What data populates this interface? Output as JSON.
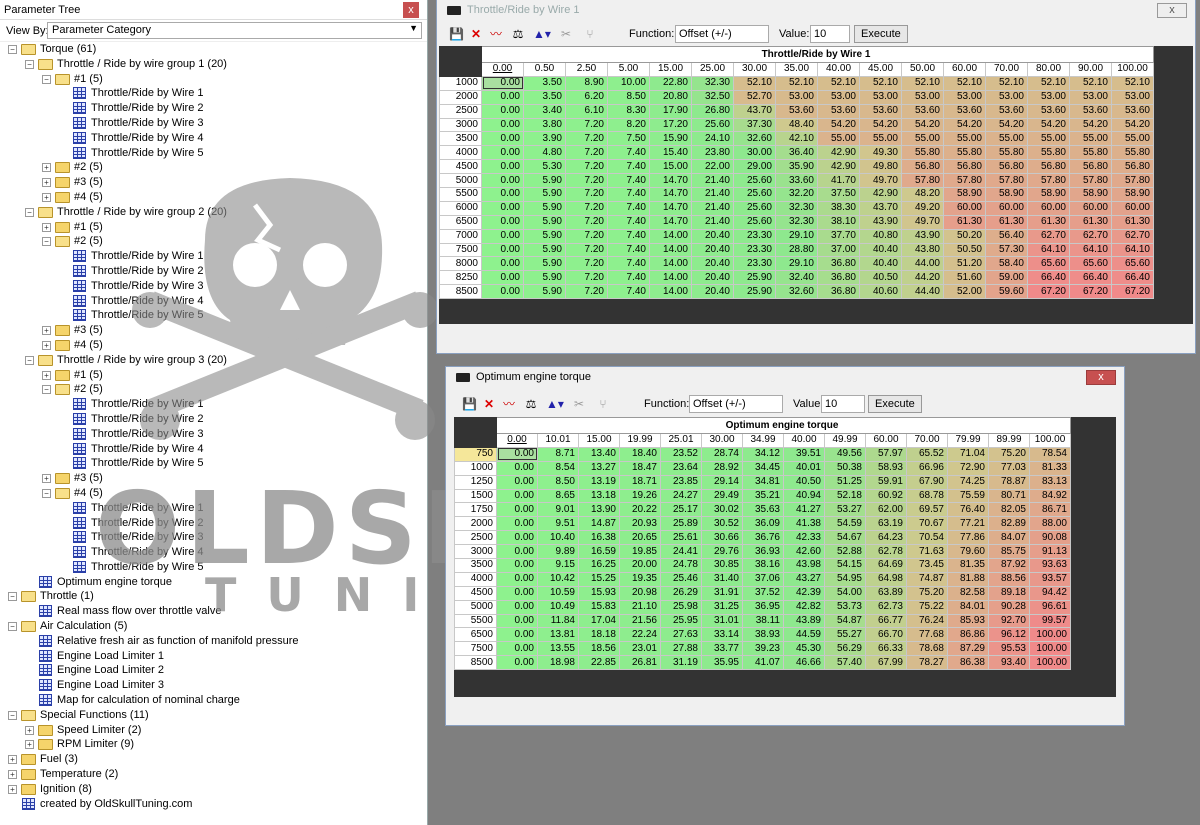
{
  "panel": {
    "title": "Parameter Tree",
    "close": "x",
    "view_by_label": "View By:",
    "view_by_value": "Parameter Category"
  },
  "tree": [
    {
      "d": 0,
      "e": "-",
      "i": "folder-open",
      "t": "Torque (61)"
    },
    {
      "d": 1,
      "e": "-",
      "i": "folder-open",
      "t": "Throttle / Ride by wire group 1 (20)"
    },
    {
      "d": 2,
      "e": "-",
      "i": "folder-open",
      "t": "#1 (5)"
    },
    {
      "d": 3,
      "e": "",
      "i": "table",
      "t": "Throttle/Ride by Wire 1"
    },
    {
      "d": 3,
      "e": "",
      "i": "table",
      "t": "Throttle/Ride by Wire 2"
    },
    {
      "d": 3,
      "e": "",
      "i": "table",
      "t": "Throttle/Ride by Wire 3"
    },
    {
      "d": 3,
      "e": "",
      "i": "table",
      "t": "Throttle/Ride by Wire 4"
    },
    {
      "d": 3,
      "e": "",
      "i": "table",
      "t": "Throttle/Ride by Wire 5"
    },
    {
      "d": 2,
      "e": "+",
      "i": "folder",
      "t": "#2 (5)"
    },
    {
      "d": 2,
      "e": "+",
      "i": "folder",
      "t": "#3 (5)"
    },
    {
      "d": 2,
      "e": "+",
      "i": "folder",
      "t": "#4 (5)"
    },
    {
      "d": 1,
      "e": "-",
      "i": "folder-open",
      "t": "Throttle / Ride by wire group 2 (20)"
    },
    {
      "d": 2,
      "e": "+",
      "i": "folder",
      "t": "#1 (5)"
    },
    {
      "d": 2,
      "e": "-",
      "i": "folder-open",
      "t": "#2 (5)"
    },
    {
      "d": 3,
      "e": "",
      "i": "table",
      "t": "Throttle/Ride by Wire 1"
    },
    {
      "d": 3,
      "e": "",
      "i": "table",
      "t": "Throttle/Ride by Wire 2"
    },
    {
      "d": 3,
      "e": "",
      "i": "table",
      "t": "Throttle/Ride by Wire 3"
    },
    {
      "d": 3,
      "e": "",
      "i": "table",
      "t": "Throttle/Ride by Wire 4"
    },
    {
      "d": 3,
      "e": "",
      "i": "table",
      "t": "Throttle/Ride by Wire 5"
    },
    {
      "d": 2,
      "e": "+",
      "i": "folder",
      "t": "#3 (5)"
    },
    {
      "d": 2,
      "e": "+",
      "i": "folder",
      "t": "#4 (5)"
    },
    {
      "d": 1,
      "e": "-",
      "i": "folder-open",
      "t": "Throttle / Ride by wire group 3 (20)"
    },
    {
      "d": 2,
      "e": "+",
      "i": "folder",
      "t": "#1 (5)"
    },
    {
      "d": 2,
      "e": "-",
      "i": "folder-open",
      "t": "#2 (5)"
    },
    {
      "d": 3,
      "e": "",
      "i": "table",
      "t": "Throttle/Ride by Wire 1"
    },
    {
      "d": 3,
      "e": "",
      "i": "table",
      "t": "Throttle/Ride by Wire 2"
    },
    {
      "d": 3,
      "e": "",
      "i": "table",
      "t": "Throttle/Ride by Wire 3"
    },
    {
      "d": 3,
      "e": "",
      "i": "table",
      "t": "Throttle/Ride by Wire 4"
    },
    {
      "d": 3,
      "e": "",
      "i": "table",
      "t": "Throttle/Ride by Wire 5"
    },
    {
      "d": 2,
      "e": "+",
      "i": "folder",
      "t": "#3 (5)"
    },
    {
      "d": 2,
      "e": "-",
      "i": "folder-open",
      "t": "#4 (5)"
    },
    {
      "d": 3,
      "e": "",
      "i": "table",
      "t": "Throttle/Ride by Wire 1"
    },
    {
      "d": 3,
      "e": "",
      "i": "table",
      "t": "Throttle/Ride by Wire 2"
    },
    {
      "d": 3,
      "e": "",
      "i": "table",
      "t": "Throttle/Ride by Wire 3"
    },
    {
      "d": 3,
      "e": "",
      "i": "table",
      "t": "Throttle/Ride by Wire 4"
    },
    {
      "d": 3,
      "e": "",
      "i": "table",
      "t": "Throttle/Ride by Wire 5"
    },
    {
      "d": 1,
      "e": "",
      "i": "table",
      "t": "Optimum engine torque"
    },
    {
      "d": 0,
      "e": "-",
      "i": "folder-open",
      "t": "Throttle (1)"
    },
    {
      "d": 1,
      "e": "",
      "i": "table",
      "t": "Real mass flow over throttle valve"
    },
    {
      "d": 0,
      "e": "-",
      "i": "folder-open",
      "t": "Air Calculation (5)"
    },
    {
      "d": 1,
      "e": "",
      "i": "table",
      "t": "Relative fresh air as function of manifold pressure"
    },
    {
      "d": 1,
      "e": "",
      "i": "table",
      "t": "Engine Load Limiter 1"
    },
    {
      "d": 1,
      "e": "",
      "i": "table",
      "t": "Engine Load Limiter 2"
    },
    {
      "d": 1,
      "e": "",
      "i": "table",
      "t": "Engine Load Limiter 3"
    },
    {
      "d": 1,
      "e": "",
      "i": "table",
      "t": "Map for calculation of nominal charge"
    },
    {
      "d": 0,
      "e": "-",
      "i": "folder-open",
      "t": "Special Functions (11)"
    },
    {
      "d": 1,
      "e": "+",
      "i": "folder",
      "t": "Speed Limiter (2)"
    },
    {
      "d": 1,
      "e": "+",
      "i": "folder",
      "t": "RPM Limiter (9)"
    },
    {
      "d": 0,
      "e": "+",
      "i": "folder",
      "t": "Fuel (3)"
    },
    {
      "d": 0,
      "e": "+",
      "i": "folder",
      "t": "Temperature (2)"
    },
    {
      "d": 0,
      "e": "+",
      "i": "folder",
      "t": "Ignition (8)"
    },
    {
      "d": 0,
      "e": "",
      "i": "table",
      "t": "created by OldSkullTuning.com"
    }
  ],
  "watermark": {
    "line1": "OLDSKULL",
    "line2": "TUNING"
  },
  "win1": {
    "title": "Throttle/Ride by Wire 1",
    "close": "x",
    "function_label": "Function:",
    "function_value": "Offset (+/-)",
    "value_label": "Value:",
    "value": "10",
    "execute": "Execute",
    "table_title": "Throttle/Ride by Wire 1",
    "x": [
      "0.00",
      "0.50",
      "2.50",
      "5.00",
      "15.00",
      "25.00",
      "30.00",
      "35.00",
      "40.00",
      "45.00",
      "50.00",
      "60.00",
      "70.00",
      "80.00",
      "90.00",
      "100.00"
    ],
    "y": [
      "1000",
      "2000",
      "2500",
      "3000",
      "3500",
      "4000",
      "4500",
      "5000",
      "5500",
      "6000",
      "6500",
      "7000",
      "7500",
      "8000",
      "8250",
      "8500"
    ],
    "rows": [
      [
        "0.00",
        "3.50",
        "8.90",
        "10.00",
        "22.80",
        "32.30",
        "52.10",
        "52.10",
        "52.10",
        "52.10",
        "52.10",
        "52.10",
        "52.10",
        "52.10",
        "52.10",
        "52.10"
      ],
      [
        "0.00",
        "3.50",
        "6.20",
        "8.50",
        "20.80",
        "32.50",
        "52.70",
        "53.00",
        "53.00",
        "53.00",
        "53.00",
        "53.00",
        "53.00",
        "53.00",
        "53.00",
        "53.00"
      ],
      [
        "0.00",
        "3.40",
        "6.10",
        "8.30",
        "17.90",
        "26.80",
        "43.70",
        "53.60",
        "53.60",
        "53.60",
        "53.60",
        "53.60",
        "53.60",
        "53.60",
        "53.60",
        "53.60"
      ],
      [
        "0.00",
        "3.80",
        "7.20",
        "8.20",
        "17.20",
        "25.60",
        "37.30",
        "48.40",
        "54.20",
        "54.20",
        "54.20",
        "54.20",
        "54.20",
        "54.20",
        "54.20",
        "54.20"
      ],
      [
        "0.00",
        "3.90",
        "7.20",
        "7.50",
        "15.90",
        "24.10",
        "32.60",
        "42.10",
        "55.00",
        "55.00",
        "55.00",
        "55.00",
        "55.00",
        "55.00",
        "55.00",
        "55.00"
      ],
      [
        "0.00",
        "4.80",
        "7.20",
        "7.40",
        "15.40",
        "23.80",
        "30.00",
        "36.40",
        "42.90",
        "49.30",
        "55.80",
        "55.80",
        "55.80",
        "55.80",
        "55.80",
        "55.80"
      ],
      [
        "0.00",
        "5.30",
        "7.20",
        "7.40",
        "15.00",
        "22.00",
        "29.00",
        "35.90",
        "42.90",
        "49.80",
        "56.80",
        "56.80",
        "56.80",
        "56.80",
        "56.80",
        "56.80"
      ],
      [
        "0.00",
        "5.90",
        "7.20",
        "7.40",
        "14.70",
        "21.40",
        "25.60",
        "33.60",
        "41.70",
        "49.70",
        "57.80",
        "57.80",
        "57.80",
        "57.80",
        "57.80",
        "57.80"
      ],
      [
        "0.00",
        "5.90",
        "7.20",
        "7.40",
        "14.70",
        "21.40",
        "25.60",
        "32.20",
        "37.50",
        "42.90",
        "48.20",
        "58.90",
        "58.90",
        "58.90",
        "58.90",
        "58.90"
      ],
      [
        "0.00",
        "5.90",
        "7.20",
        "7.40",
        "14.70",
        "21.40",
        "25.60",
        "32.30",
        "38.30",
        "43.70",
        "49.20",
        "60.00",
        "60.00",
        "60.00",
        "60.00",
        "60.00"
      ],
      [
        "0.00",
        "5.90",
        "7.20",
        "7.40",
        "14.70",
        "21.40",
        "25.60",
        "32.30",
        "38.10",
        "43.90",
        "49.70",
        "61.30",
        "61.30",
        "61.30",
        "61.30",
        "61.30"
      ],
      [
        "0.00",
        "5.90",
        "7.20",
        "7.40",
        "14.00",
        "20.40",
        "23.30",
        "29.10",
        "37.70",
        "40.80",
        "43.90",
        "50.20",
        "56.40",
        "62.70",
        "62.70",
        "62.70"
      ],
      [
        "0.00",
        "5.90",
        "7.20",
        "7.40",
        "14.00",
        "20.40",
        "23.30",
        "28.80",
        "37.00",
        "40.40",
        "43.80",
        "50.50",
        "57.30",
        "64.10",
        "64.10",
        "64.10"
      ],
      [
        "0.00",
        "5.90",
        "7.20",
        "7.40",
        "14.00",
        "20.40",
        "23.30",
        "29.10",
        "36.80",
        "40.40",
        "44.00",
        "51.20",
        "58.40",
        "65.60",
        "65.60",
        "65.60"
      ],
      [
        "0.00",
        "5.90",
        "7.20",
        "7.40",
        "14.00",
        "20.40",
        "25.90",
        "32.40",
        "36.80",
        "40.50",
        "44.20",
        "51.60",
        "59.00",
        "66.40",
        "66.40",
        "66.40"
      ],
      [
        "0.00",
        "5.90",
        "7.20",
        "7.40",
        "14.00",
        "20.40",
        "25.90",
        "32.60",
        "36.80",
        "40.60",
        "44.40",
        "52.00",
        "59.60",
        "67.20",
        "67.20",
        "67.20"
      ]
    ]
  },
  "win2": {
    "title": "Optimum engine torque",
    "close": "x",
    "function_label": "Function:",
    "function_value": "Offset (+/-)",
    "value_label": "Value:",
    "value": "10",
    "execute": "Execute",
    "table_title": "Optimum engine torque",
    "x": [
      "0.00",
      "10.01",
      "15.00",
      "19.99",
      "25.01",
      "30.00",
      "34.99",
      "40.00",
      "49.99",
      "60.00",
      "70.00",
      "79.99",
      "89.99",
      "100.00"
    ],
    "y": [
      "750",
      "1000",
      "1250",
      "1500",
      "1750",
      "2000",
      "2500",
      "3000",
      "3500",
      "4000",
      "4500",
      "5000",
      "5500",
      "6500",
      "7500",
      "8500"
    ],
    "rows": [
      [
        "0.00",
        "8.71",
        "13.40",
        "18.40",
        "23.52",
        "28.74",
        "34.12",
        "39.51",
        "49.56",
        "57.97",
        "65.52",
        "71.04",
        "75.20",
        "78.54"
      ],
      [
        "0.00",
        "8.54",
        "13.27",
        "18.47",
        "23.64",
        "28.92",
        "34.45",
        "40.01",
        "50.38",
        "58.93",
        "66.96",
        "72.90",
        "77.03",
        "81.33"
      ],
      [
        "0.00",
        "8.50",
        "13.19",
        "18.71",
        "23.85",
        "29.14",
        "34.81",
        "40.50",
        "51.25",
        "59.91",
        "67.90",
        "74.25",
        "78.87",
        "83.13"
      ],
      [
        "0.00",
        "8.65",
        "13.18",
        "19.26",
        "24.27",
        "29.49",
        "35.21",
        "40.94",
        "52.18",
        "60.92",
        "68.78",
        "75.59",
        "80.71",
        "84.92"
      ],
      [
        "0.00",
        "9.01",
        "13.90",
        "20.22",
        "25.17",
        "30.02",
        "35.63",
        "41.27",
        "53.27",
        "62.00",
        "69.57",
        "76.40",
        "82.05",
        "86.71"
      ],
      [
        "0.00",
        "9.51",
        "14.87",
        "20.93",
        "25.89",
        "30.52",
        "36.09",
        "41.38",
        "54.59",
        "63.19",
        "70.67",
        "77.21",
        "82.89",
        "88.00"
      ],
      [
        "0.00",
        "10.40",
        "16.38",
        "20.65",
        "25.61",
        "30.66",
        "36.76",
        "42.33",
        "54.67",
        "64.23",
        "70.54",
        "77.86",
        "84.07",
        "90.08"
      ],
      [
        "0.00",
        "9.89",
        "16.59",
        "19.85",
        "24.41",
        "29.76",
        "36.93",
        "42.60",
        "52.88",
        "62.78",
        "71.63",
        "79.60",
        "85.75",
        "91.13"
      ],
      [
        "0.00",
        "9.15",
        "16.25",
        "20.00",
        "24.78",
        "30.85",
        "38.16",
        "43.98",
        "54.15",
        "64.69",
        "73.45",
        "81.35",
        "87.92",
        "93.63"
      ],
      [
        "0.00",
        "10.42",
        "15.25",
        "19.35",
        "25.46",
        "31.40",
        "37.06",
        "43.27",
        "54.95",
        "64.98",
        "74.87",
        "81.88",
        "88.56",
        "93.57"
      ],
      [
        "0.00",
        "10.59",
        "15.93",
        "20.98",
        "26.29",
        "31.91",
        "37.52",
        "42.39",
        "54.00",
        "63.89",
        "75.20",
        "82.58",
        "89.18",
        "94.42"
      ],
      [
        "0.00",
        "10.49",
        "15.83",
        "21.10",
        "25.98",
        "31.25",
        "36.95",
        "42.82",
        "53.73",
        "62.73",
        "75.22",
        "84.01",
        "90.28",
        "96.61"
      ],
      [
        "0.00",
        "11.84",
        "17.04",
        "21.56",
        "25.95",
        "31.01",
        "38.11",
        "43.89",
        "54.87",
        "66.77",
        "76.24",
        "85.93",
        "92.70",
        "99.57"
      ],
      [
        "0.00",
        "13.81",
        "18.18",
        "22.24",
        "27.63",
        "33.14",
        "38.93",
        "44.59",
        "55.27",
        "66.70",
        "77.68",
        "86.86",
        "96.12",
        "100.00"
      ],
      [
        "0.00",
        "13.55",
        "18.56",
        "23.01",
        "27.88",
        "33.77",
        "39.23",
        "45.30",
        "56.29",
        "66.33",
        "78.68",
        "87.29",
        "95.53",
        "100.00"
      ],
      [
        "0.00",
        "18.98",
        "22.85",
        "26.81",
        "31.19",
        "35.95",
        "41.07",
        "46.66",
        "57.40",
        "67.99",
        "78.27",
        "86.38",
        "93.40",
        "100.00"
      ]
    ]
  },
  "colors": {
    "low": "#8ef28e",
    "mid": "#cfc98e",
    "high": "#f08a8a",
    "selected": "#a9e0a0",
    "y_selected": "#f5e79a"
  }
}
